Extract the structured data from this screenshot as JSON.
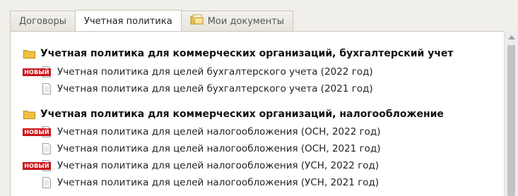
{
  "tabs": [
    {
      "label": "Договоры",
      "active": false
    },
    {
      "label": "Учетная политика",
      "active": true
    },
    {
      "label": "Мои документы",
      "active": false,
      "icon": "documents-icon"
    }
  ],
  "sections": [
    {
      "title": "Учетная политика для коммерческих организаций, бухгалтерский учет",
      "items": [
        {
          "label": "Учетная политика для целей бухгалтерского учета (2022 год)",
          "badge": "НОВЫЙ"
        },
        {
          "label": "Учетная политика для целей бухгалтерского учета (2021 год)",
          "badge": ""
        }
      ]
    },
    {
      "title": "Учетная политика для коммерческих организаций, налогообложение",
      "items": [
        {
          "label": "Учетная политика для целей налогообложения (ОСН, 2022 год)",
          "badge": "НОВЫЙ"
        },
        {
          "label": "Учетная политика для целей налогообложения (ОСН, 2021 год)",
          "badge": ""
        },
        {
          "label": "Учетная политика для целей налогообложения (УСН, 2022 год)",
          "badge": "НОВЫЙ"
        },
        {
          "label": "Учетная политика для целей налогообложения (УСН, 2021 год)",
          "badge": ""
        }
      ]
    }
  ],
  "colors": {
    "badge": "#c8171d",
    "folder": "#f0c040"
  }
}
